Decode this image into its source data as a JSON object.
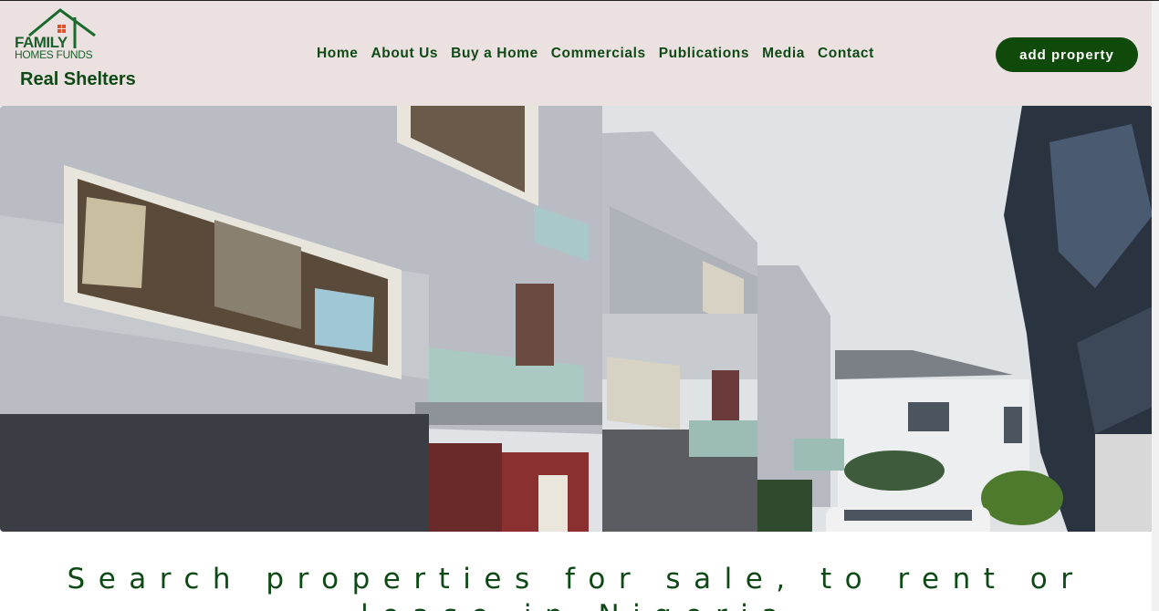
{
  "brand": {
    "logo_line1": "FAMILY",
    "logo_line2": "HOMES FUNDS",
    "name": "Real Shelters",
    "logo_icon": "house-roof-icon",
    "primary_color": "#0f4a16"
  },
  "nav": {
    "items": [
      {
        "label": "Home"
      },
      {
        "label": "About Us"
      },
      {
        "label": "Buy a Home"
      },
      {
        "label": "Commercials"
      },
      {
        "label": "Publications"
      },
      {
        "label": "Media"
      },
      {
        "label": "Contact"
      }
    ],
    "cta_label": "add property"
  },
  "hero": {
    "image": "residential-townhouses-photo"
  },
  "headline": {
    "text": "Search properties for sale, to rent or lease in Nigeria"
  }
}
